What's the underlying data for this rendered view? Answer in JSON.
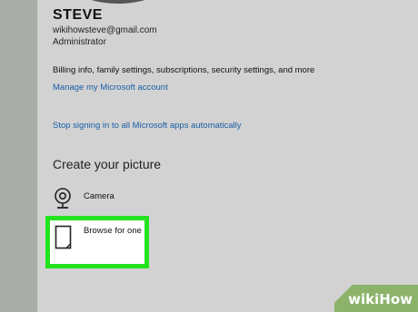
{
  "account": {
    "name": "STEVE",
    "email": "wikihowsteve@gmail.com",
    "role": "Administrator",
    "billing_text": "Billing info, family settings, subscriptions, security settings, and more",
    "manage_link": "Manage my Microsoft account",
    "stop_link": "Stop signing in to all Microsoft apps automatically"
  },
  "picture": {
    "title": "Create your picture",
    "options": [
      {
        "label": "Camera",
        "icon": "webcam-icon"
      },
      {
        "label": "Browse for one",
        "icon": "file-icon"
      }
    ]
  },
  "watermark": {
    "wiki": "wiki",
    "how": "How"
  },
  "colors": {
    "highlight": "#22e31e",
    "link": "#1a5fa8",
    "panel": "#d2d2d2"
  }
}
